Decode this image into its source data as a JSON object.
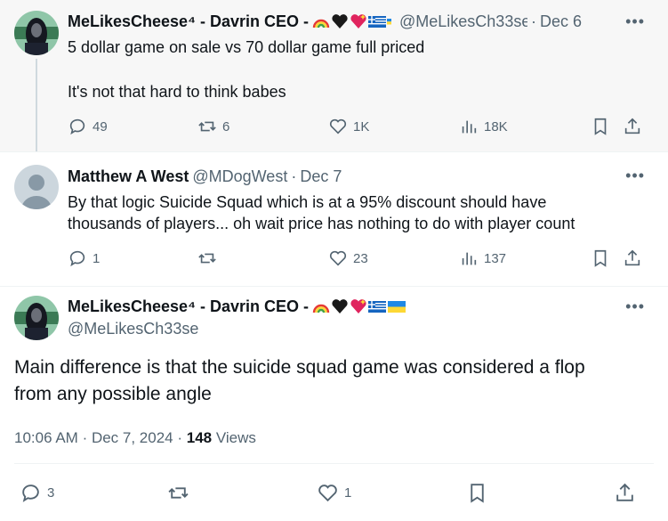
{
  "posts": [
    {
      "author": "MeLikesCheese⁴ - Davrin CEO -",
      "handle": "@MeLikesCh33se",
      "dot": "·",
      "date": "Dec 6",
      "text_lines": [
        "5 dollar game on sale vs 70 dollar game full priced",
        "",
        "It's not that hard to think babes"
      ],
      "replies": "49",
      "reposts": "6",
      "likes": "1K",
      "views": "18K"
    },
    {
      "author": "Matthew A West",
      "handle": "@MDogWest",
      "dot": "·",
      "date": "Dec 7",
      "text_lines": [
        "By that logic Suicide Squad which is at a 95% discount should have",
        "thousands of players... oh wait price has nothing to do with player count"
      ],
      "replies": "1",
      "reposts": "",
      "likes": "23",
      "views": "137"
    }
  ],
  "main_post": {
    "author": "MeLikesCheese⁴ - Davrin CEO -",
    "handle": "@MeLikesCh33se",
    "text_lines": [
      "Main difference is that the suicide squad game was considered a flop",
      "from any possible angle"
    ],
    "time": "10:06 AM",
    "date": "Dec 7, 2024",
    "views_count": "148",
    "views_label": "Views",
    "replies": "3",
    "reposts": "",
    "likes": "1"
  },
  "more_label": "•••",
  "colors": {
    "muted": "#536471",
    "text": "#0f1419",
    "line": "#cfd9de"
  }
}
